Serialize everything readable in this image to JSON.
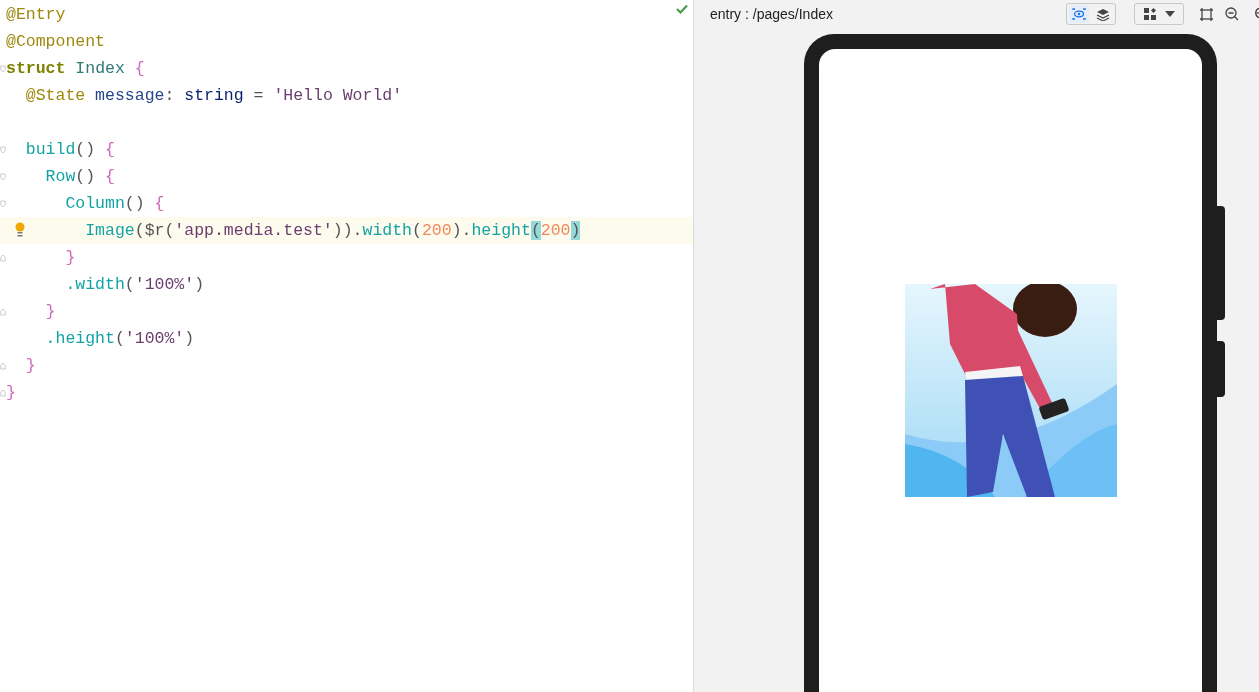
{
  "editor": {
    "lines": [
      {
        "current": false,
        "kind": "plain",
        "tokens": [
          {
            "kind": "decorator",
            "text": "@Entry"
          }
        ]
      },
      {
        "current": false,
        "kind": "plain",
        "tokens": [
          {
            "kind": "decorator",
            "text": "@Component"
          }
        ]
      },
      {
        "current": false,
        "kind": "fold_start",
        "tokens": [
          {
            "kind": "keyword",
            "text": "struct"
          },
          {
            "kind": "type",
            "text": " Index "
          },
          {
            "kind": "brace",
            "text": "{"
          }
        ]
      },
      {
        "current": false,
        "kind": "plain",
        "tokens": [
          {
            "kind": "decorator",
            "text": "  @State"
          },
          {
            "kind": "field",
            "text": " message"
          },
          {
            "kind": "punct",
            "text": ": "
          },
          {
            "kind": "builtin",
            "text": "string"
          },
          {
            "kind": "punct",
            "text": " = "
          },
          {
            "kind": "string",
            "text": "'Hello World'"
          }
        ]
      },
      {
        "current": false,
        "kind": "blank"
      },
      {
        "current": false,
        "kind": "fold_start",
        "tokens": [
          {
            "kind": "call",
            "text": "  build"
          },
          {
            "kind": "punct",
            "text": "() "
          },
          {
            "kind": "brace",
            "text": "{"
          }
        ]
      },
      {
        "current": false,
        "kind": "fold_start",
        "tokens": [
          {
            "kind": "call",
            "text": "    Row"
          },
          {
            "kind": "punct",
            "text": "() "
          },
          {
            "kind": "brace",
            "text": "{"
          }
        ]
      },
      {
        "current": false,
        "kind": "fold_start",
        "tokens": [
          {
            "kind": "call",
            "text": "      Column"
          },
          {
            "kind": "punct",
            "text": "() "
          },
          {
            "kind": "brace",
            "text": "{"
          }
        ]
      },
      {
        "current": true,
        "kind": "plain",
        "tokens": [
          {
            "kind": "call",
            "text": "        Image"
          },
          {
            "kind": "punct",
            "text": "($r("
          },
          {
            "kind": "string",
            "text": "'app.media.test'"
          },
          {
            "kind": "punct",
            "text": "))."
          },
          {
            "kind": "call",
            "text": "width"
          },
          {
            "kind": "punct",
            "text": "("
          },
          {
            "kind": "number",
            "text": "200"
          },
          {
            "kind": "punct",
            "text": ")."
          },
          {
            "kind": "call",
            "text": "height"
          },
          {
            "kind": "match",
            "text": "("
          },
          {
            "kind": "number",
            "text": "200"
          },
          {
            "kind": "match",
            "text": ")"
          }
        ]
      },
      {
        "current": false,
        "kind": "fold_end",
        "tokens": [
          {
            "kind": "brace",
            "text": "      }"
          }
        ]
      },
      {
        "current": false,
        "kind": "plain",
        "tokens": [
          {
            "kind": "call",
            "text": "      .width"
          },
          {
            "kind": "punct",
            "text": "("
          },
          {
            "kind": "string",
            "text": "'100%'"
          },
          {
            "kind": "punct",
            "text": ")"
          }
        ]
      },
      {
        "current": false,
        "kind": "fold_end",
        "tokens": [
          {
            "kind": "brace",
            "text": "    }"
          }
        ]
      },
      {
        "current": false,
        "kind": "plain",
        "tokens": [
          {
            "kind": "call",
            "text": "    .height"
          },
          {
            "kind": "punct",
            "text": "("
          },
          {
            "kind": "string",
            "text": "'100%'"
          },
          {
            "kind": "punct",
            "text": ")"
          }
        ]
      },
      {
        "current": false,
        "kind": "fold_end",
        "tokens": [
          {
            "kind": "brace",
            "text": "  }"
          }
        ]
      },
      {
        "current": false,
        "kind": "fold_end",
        "tokens": [
          {
            "kind": "brace",
            "text": "}"
          }
        ]
      }
    ]
  },
  "preview": {
    "path": "entry : /pages/Index",
    "toggles": [
      {
        "kind": "eye",
        "selected": true
      },
      {
        "kind": "layers",
        "selected": false
      }
    ]
  }
}
